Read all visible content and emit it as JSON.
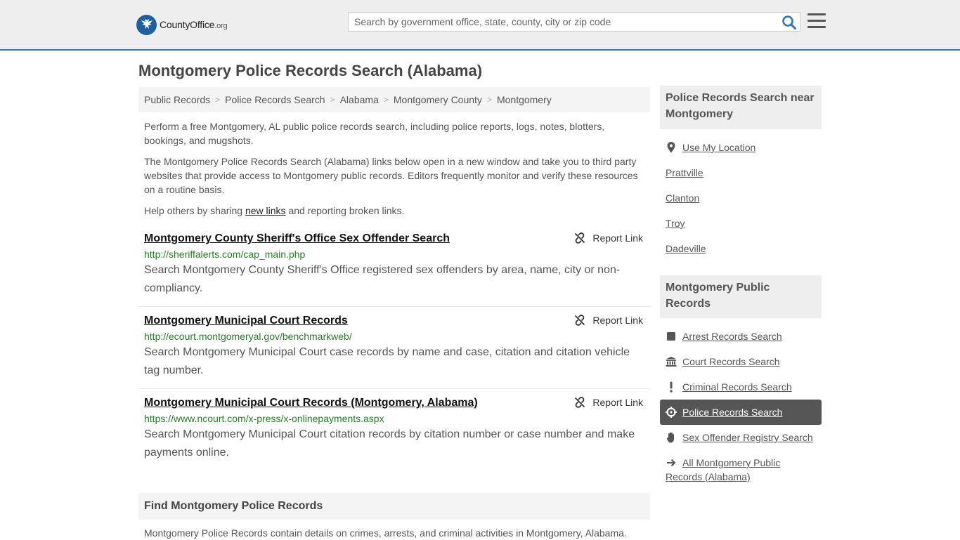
{
  "header": {
    "logo_main": "CountyOffice",
    "logo_tld": ".org",
    "search_placeholder": "Search by government office, state, county, city or zip code"
  },
  "page": {
    "title": "Montgomery Police Records Search (Alabama)"
  },
  "breadcrumb": [
    "Public Records",
    "Police Records Search",
    "Alabama",
    "Montgomery County",
    "Montgomery"
  ],
  "intro": {
    "p1": "Perform a free Montgomery, AL public police records search, including police reports, logs, notes, blotters, bookings, and mugshots.",
    "p2": "The Montgomery Police Records Search (Alabama) links below open in a new window and take you to third party websites that provide access to Montgomery public records. Editors frequently monitor and verify these resources on a routine basis.",
    "p3_before": "Help others by sharing ",
    "p3_link": "new links",
    "p3_after": " and reporting broken links."
  },
  "results": [
    {
      "title": "Montgomery County Sheriff's Office Sex Offender Search",
      "url": "http://sheriffalerts.com/cap_main.php",
      "description": "Search Montgomery County Sheriff's Office registered sex offenders by area, name, city or non-compliancy.",
      "report_label": "Report Link"
    },
    {
      "title": "Montgomery Municipal Court Records",
      "url": "http://ecourt.montgomeryal.gov/benchmarkweb/",
      "description": "Search Montgomery Municipal Court case records by name and case, citation and citation vehicle tag number.",
      "report_label": "Report Link"
    },
    {
      "title": "Montgomery Municipal Court Records (Montgomery, Alabama)",
      "url": "https://www.ncourt.com/x-press/x-onlinepayments.aspx",
      "description": "Search Montgomery Municipal Court citation records by citation number or case number and make payments online.",
      "report_label": "Report Link"
    }
  ],
  "find": {
    "heading": "Find Montgomery Police Records",
    "text": "Montgomery Police Records contain details on crimes, arrests, and criminal activities in Montgomery, Alabama."
  },
  "sidebar": {
    "nearby_heading": "Police Records Search near Montgomery",
    "use_location": "Use My Location",
    "nearby": [
      "Prattville",
      "Clanton",
      "Troy",
      "Dadeville"
    ],
    "public_heading": "Montgomery Public Records",
    "records": [
      {
        "label": "Arrest Records Search",
        "icon": "square-icon"
      },
      {
        "label": "Court Records Search",
        "icon": "courthouse-icon"
      },
      {
        "label": "Criminal Records Search",
        "icon": "exclamation-icon"
      },
      {
        "label": "Police Records Search",
        "icon": "crosshair-icon"
      },
      {
        "label": "Sex Offender Registry Search",
        "icon": "hand-icon"
      }
    ],
    "all_records": "All Montgomery Public Records (Alabama)"
  },
  "colors": {
    "header_bg": "#eeeeee",
    "header_border": "#2e77b8",
    "url_green": "#2a7a2a",
    "active_bg": "#555555"
  }
}
